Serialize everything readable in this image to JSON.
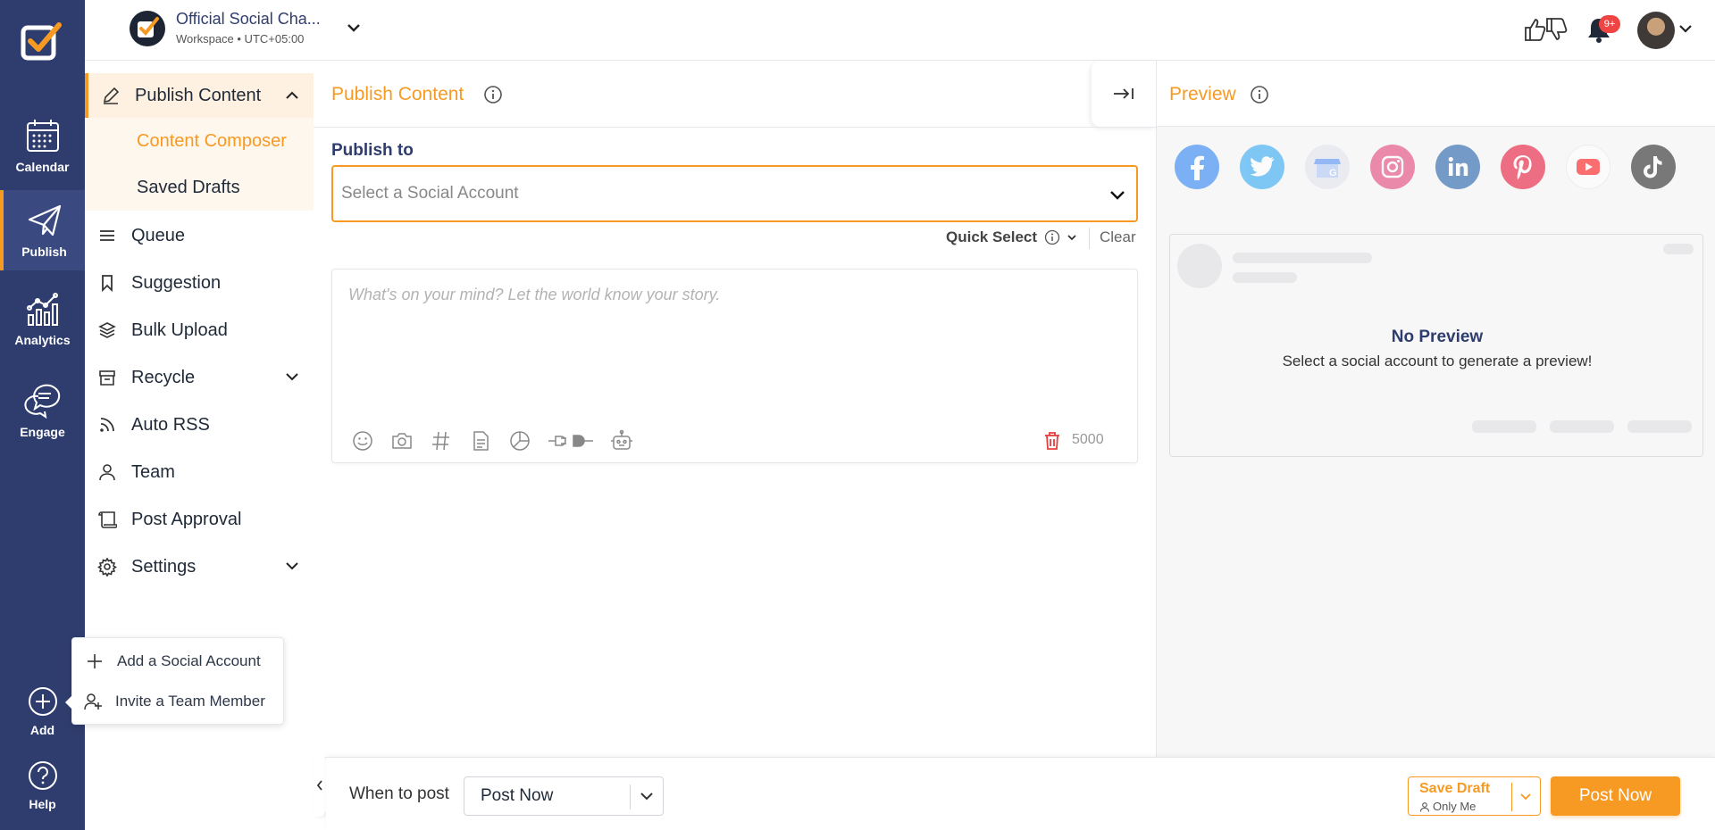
{
  "rail": {
    "items": [
      {
        "label": "Calendar"
      },
      {
        "label": "Publish"
      },
      {
        "label": "Analytics"
      },
      {
        "label": "Engage"
      }
    ],
    "add_label": "Add",
    "help_label": "Help"
  },
  "header": {
    "workspace_name": "Official Social Cha...",
    "workspace_sub": "Workspace • UTC+05:00",
    "notification_badge": "9+"
  },
  "subnav": {
    "header_label": "Publish Content",
    "sub_items": [
      {
        "label": "Content Composer"
      },
      {
        "label": "Saved Drafts"
      }
    ],
    "items": [
      {
        "label": "Queue"
      },
      {
        "label": "Suggestion"
      },
      {
        "label": "Bulk Upload"
      },
      {
        "label": "Recycle"
      },
      {
        "label": "Auto RSS"
      },
      {
        "label": "Team"
      },
      {
        "label": "Post Approval"
      },
      {
        "label": "Settings"
      }
    ]
  },
  "add_popup": {
    "items": [
      {
        "label": "Add a Social Account"
      },
      {
        "label": "Invite a Team Member"
      }
    ]
  },
  "main": {
    "title": "Publish Content",
    "publish_to_label": "Publish to",
    "account_placeholder": "Select a Social Account",
    "quick_select_label": "Quick Select",
    "clear_label": "Clear",
    "composer_placeholder": "What's on your mind? Let the world know your story.",
    "char_count": "5000"
  },
  "preview": {
    "title": "Preview",
    "networks": [
      "facebook",
      "twitter",
      "google-business",
      "instagram",
      "linkedin",
      "pinterest",
      "youtube",
      "tiktok"
    ],
    "no_preview_title": "No Preview",
    "no_preview_text": "Select a social account to generate a preview!"
  },
  "footer": {
    "when_label": "When to post",
    "when_value": "Post Now",
    "save_draft_label": "Save Draft",
    "save_draft_sub": "Only Me",
    "post_now_label": "Post Now"
  },
  "colors": {
    "rail": "#2f3d6e",
    "accent": "#f79a24",
    "navy_text": "#2f3d6e"
  }
}
